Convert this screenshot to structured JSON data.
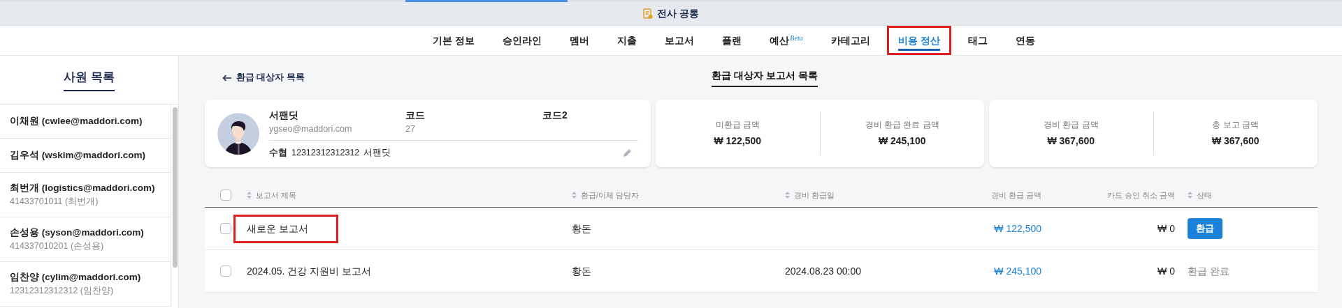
{
  "header": {
    "title": "전사 공통"
  },
  "nav": [
    {
      "label": "기본 정보",
      "selected": false,
      "highlighted": false
    },
    {
      "label": "승인라인",
      "selected": false,
      "highlighted": false
    },
    {
      "label": "멤버",
      "selected": false,
      "highlighted": false
    },
    {
      "label": "지출",
      "selected": false,
      "highlighted": false
    },
    {
      "label": "보고서",
      "selected": false,
      "highlighted": false
    },
    {
      "label": "플랜",
      "selected": false,
      "highlighted": false
    },
    {
      "label": "예산",
      "badge": "Beta",
      "selected": false,
      "highlighted": false
    },
    {
      "label": "카테고리",
      "selected": false,
      "highlighted": false
    },
    {
      "label": "비용 정산",
      "selected": true,
      "highlighted": true
    },
    {
      "label": "태그",
      "selected": false,
      "highlighted": false
    },
    {
      "label": "연동",
      "selected": false,
      "highlighted": false
    }
  ],
  "sidebar": {
    "title": "사원 목록",
    "items": [
      {
        "name": "이채원 (cwlee@maddori.com)"
      },
      {
        "name": "김우석 (wskim@maddori.com)"
      },
      {
        "name": "최번개 (logistics@maddori.com)",
        "sub": "41433701011 (최번개)"
      },
      {
        "name": "손성용 (syson@maddori.com)",
        "sub": "414337010201 (손성용)"
      },
      {
        "name": "임찬양 (cylim@maddori.com)",
        "sub": "12312312312312 (임찬양)"
      }
    ]
  },
  "back_link": "환급 대상자 목록",
  "page_title": "환급 대상자 보고서 목록",
  "profile": {
    "name": "서팬딧",
    "email": "ygseo@maddori.com",
    "code_label": "코드",
    "code": "27",
    "code2_label": "코드2",
    "bank": "수협",
    "account": "12312312312312",
    "holder": "서팬딧"
  },
  "summary_cards": [
    [
      {
        "label": "미환급 금액",
        "value": "₩ 122,500"
      },
      {
        "label": "경비 환급 완료 금액",
        "value": "₩ 245,100"
      }
    ],
    [
      {
        "label": "경비 환급 금액",
        "value": "₩ 367,600"
      },
      {
        "label": "총 보고 금액",
        "value": "₩ 367,600"
      }
    ]
  ],
  "table": {
    "all_checked": false,
    "columns": [
      {
        "label": "보고서 제목",
        "sortable": true
      },
      {
        "label": "환급/이체 담당자",
        "sortable": true
      },
      {
        "label": "경비 환급일",
        "sortable": true
      },
      {
        "label": "경비 환급 금액",
        "sortable": false
      },
      {
        "label": "카드 승인 취소 금액",
        "sortable": false
      },
      {
        "label": "상태",
        "sortable": true
      }
    ],
    "rows": [
      {
        "checked": false,
        "title": "새로운 보고서",
        "highlighted": true,
        "manager": "황돈",
        "amount": "₩ 122,500",
        "card_cancel": "₩ 0",
        "status": {
          "kind": "button",
          "label": "환급"
        }
      },
      {
        "checked": false,
        "title": "2024.05. 건강 지원비 보고서",
        "highlighted": false,
        "manager": "황돈",
        "refund_date": "2024.08.23 00:00",
        "amount": "₩ 245,100",
        "card_cancel": "₩ 0",
        "status": {
          "kind": "text",
          "label": "환급 완료"
        }
      }
    ]
  }
}
